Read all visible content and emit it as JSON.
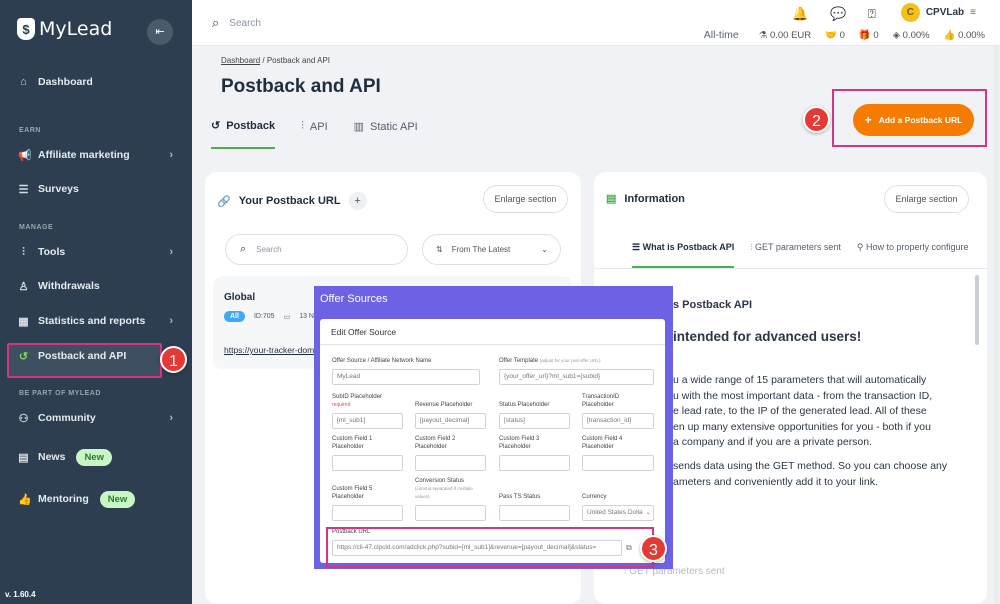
{
  "sidebar": {
    "brand": "MyLead",
    "sections": {
      "earn": "EARN",
      "manage": "MANAGE",
      "part": "BE PART OF MYLEAD"
    },
    "items": {
      "dashboard": "Dashboard",
      "affiliate": "Affiliate marketing",
      "surveys": "Surveys",
      "tools": "Tools",
      "withdrawals": "Withdrawals",
      "stats": "Statistics and reports",
      "postback": "Postback and API",
      "community": "Community",
      "news": "News",
      "mentoring": "Mentoring"
    },
    "new_badge": "New",
    "version": "v. 1.60.4"
  },
  "steps": {
    "one": "1",
    "two": "2",
    "three": "3"
  },
  "topbar": {
    "search": "Search",
    "user": "CPVLab",
    "coin": "C",
    "period": "All-time",
    "eur": "0.00 EUR",
    "leads": "0",
    "gifts": "0",
    "pct1": "0.00%",
    "pct2": "0.00%"
  },
  "page": {
    "crumb_home": "Dashboard",
    "crumb_sep": "/",
    "crumb_current": "Postback and API",
    "title": "Postback and API",
    "tabs": {
      "postback": "Postback",
      "api": "API",
      "static": "Static API"
    },
    "add_button": "Add a Postback URL"
  },
  "left_panel": {
    "title": "Your Postback URL",
    "plus": "+",
    "enlarge": "Enlarge section",
    "search": "Search",
    "sort": "From The Latest",
    "card": {
      "name": "Global",
      "pill": "All",
      "id": "ID:705",
      "date": "13 N",
      "url": "https://your-tracker-dom"
    }
  },
  "right_panel": {
    "title": "Information",
    "enlarge": "Enlarge section",
    "tabs": [
      "What is Postback API",
      "GET parameters sent",
      "How to properly configure"
    ],
    "heading": "s Postback API",
    "subheading": "intended for advanced users!",
    "para1": [
      "u a wide range of 15 parameters that will automatically",
      "u with the most important data - from the transaction ID,",
      "e lead rate, to the IP of the generated lead. All of these",
      "en up many extensive opportunities for you - both if you",
      "a company and if you are a private person."
    ],
    "para2": [
      "sends data using the GET method. So you can choose any",
      "ameters and conveniently add it to your link."
    ],
    "ghost": "GET parameters sent"
  },
  "modal": {
    "title": "Offer Sources",
    "header": "Edit Offer Source",
    "labels": {
      "source": "Offer Source / Affiliate Network Name",
      "template": "Offer Template",
      "template_hint": "(adjust for your real offer URL)",
      "subid": "SubID Placeholder",
      "required": "required",
      "revenue": "Revenue Placeholder",
      "status": "Status Placeholder",
      "txid": "TransactionID Placeholder",
      "cf1": "Custom Field 1 Placeholder",
      "cf2": "Custom Field 2 Placeholder",
      "cf3": "Custom Field 3 Placeholder",
      "cf4": "Custom Field 4 Placeholder",
      "cf5": "Custom Field 5 Placeholder",
      "conv": "Conversion Status",
      "conv_hint": "(comma separated if multiple values)",
      "pass": "Pass TS Status",
      "currency": "Currency",
      "postback": "Postback URL"
    },
    "values": {
      "source": "MyLead",
      "template": "{your_offer_url}?ml_sub1={subid}",
      "subid": "[ml_sub1]",
      "revenue": "[payout_decimal]",
      "status": "[status]",
      "txid": "[transaction_id]",
      "currency": "United States Dolla",
      "postback": "https://cli-47.clpcld.com/adclick.php?subid=[ml_sub1]&revenue=[payout_decimal]&status="
    }
  }
}
